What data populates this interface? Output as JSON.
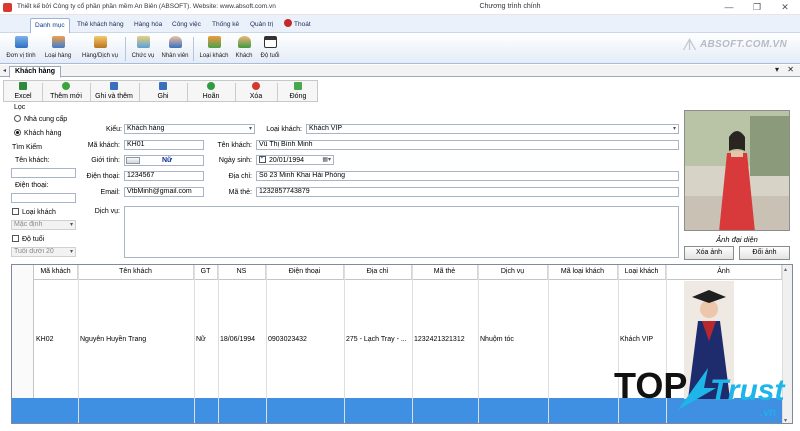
{
  "window": {
    "credit": "Thiết kế bởi Công ty cổ phần phần mềm An Biên (ABSOFT). Website: www.absoft.com.vn",
    "title": "Chương trình chính",
    "minimize": "—",
    "maximize": "❐",
    "close": "✕"
  },
  "menu": {
    "tabs": [
      "Danh mục",
      "Thẻ khách hàng",
      "Hàng hóa",
      "Công việc",
      "Thống kê",
      "Quản trị",
      "Thoát"
    ]
  },
  "ribbon": {
    "groups": [
      {
        "label": "Đơn vị tính",
        "icon": "unit-icon"
      },
      {
        "label": "Loại hàng",
        "icon": "category-icon"
      },
      {
        "label": "Hàng/Dịch vụ",
        "icon": "box-icon"
      },
      {
        "label": "Chức vụ",
        "icon": "position-icon"
      },
      {
        "label": "Nhân viên",
        "icon": "employee-icon"
      },
      {
        "label": "Loại khách",
        "icon": "customer-type-icon"
      },
      {
        "label": "Khách",
        "icon": "customer-icon"
      },
      {
        "label": "Độ tuổi",
        "icon": "calendar-icon"
      }
    ],
    "logo": "ABSOFT.COM.VN"
  },
  "doc": {
    "tab": "Khách hàng",
    "pin": "▾",
    "close": "✕"
  },
  "toolbar": {
    "excel": "Excel",
    "add": "Thêm mới",
    "save_add": "Ghi và thêm",
    "save": "Ghi",
    "cancel": "Hoãn",
    "delete": "Xóa",
    "close": "Đóng"
  },
  "filter": {
    "group_label": "Lọc",
    "opt_supplier": "Nhà cung cấp",
    "opt_customer": "Khách hàng",
    "search_label": "Tìm Kiếm",
    "name_label": "Tên khách:",
    "name_value": "",
    "phone_label": "Điện thoại:",
    "phone_value": "",
    "type_check": "Loại khách",
    "type_value": "Mặc định",
    "age_check": "Độ tuổi",
    "age_value": "Tuổi dưới 20"
  },
  "form": {
    "kind_label": "Kiểu:",
    "kind_value": "Khách hàng",
    "custtype_label": "Loại khách:",
    "custtype_value": "Khách VIP",
    "code_label": "Mã khách:",
    "code_value": "KH01",
    "name_label": "Tên khách:",
    "name_value": "Vũ Thị Bình Minh",
    "gender_label": "Giới tính:",
    "gender_value": "Nữ",
    "dob_label": "Ngày sinh:",
    "dob_value": "20/01/1994",
    "phone_label": "Điện thoại:",
    "phone_value": "1234567",
    "address_label": "Địa chỉ:",
    "address_value": "Số 23 Minh Khai Hải Phòng",
    "email_label": "Email:",
    "email_value": "VtbMinh@gmail.com",
    "card_label": "Mã thẻ:",
    "card_value": "1232857743879",
    "service_label": "Dịch vụ:",
    "service_value": ""
  },
  "photo": {
    "caption": "Ảnh đại diện",
    "remove": "Xóa ảnh",
    "change": "Đổi ảnh"
  },
  "grid": {
    "columns": [
      "Mã khách",
      "Tên khách",
      "GT",
      "NS",
      "Điện thoại",
      "Địa chỉ",
      "Mã thẻ",
      "Dịch vụ",
      "Mã loại khách",
      "Loại khách",
      "Ảnh"
    ],
    "rows": [
      [
        "KH02",
        "Nguyễn Huyền Trang",
        "Nữ",
        "18/06/1994",
        "0903023432",
        "275 - Lạch Tray - ...",
        "1232421321312",
        "Nhuộm tóc",
        "",
        "Khách VIP",
        ""
      ]
    ]
  },
  "watermark": {
    "top": "TOP",
    "trust": "Trust",
    "vn": ".vn"
  },
  "colors": {
    "selected_row": "#3f8fe3",
    "menu_active": "#0b3d91",
    "exit_icon": "#c62828"
  }
}
